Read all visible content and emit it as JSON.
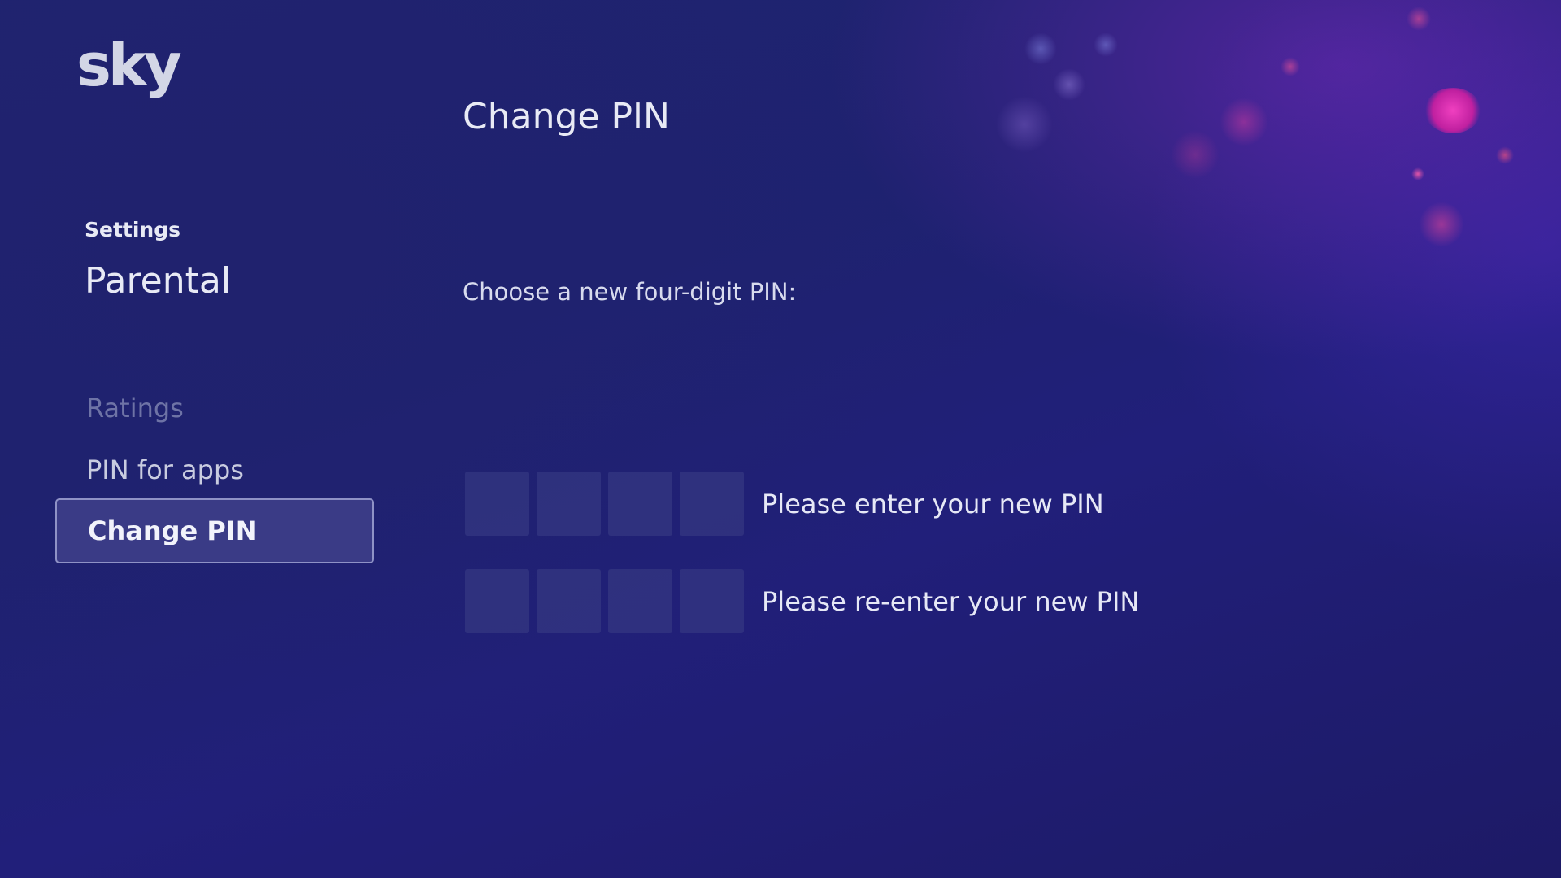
{
  "brand": {
    "logo_text": "sky"
  },
  "sidebar": {
    "settings_label": "Settings",
    "section_title": "Parental",
    "items": [
      {
        "label": "Ratings",
        "state": "disabled"
      },
      {
        "label": "PIN for apps",
        "state": "normal"
      },
      {
        "label": "Change PIN",
        "state": "selected"
      }
    ]
  },
  "main": {
    "title": "Change PIN",
    "instruction": "Choose a new four-digit PIN:",
    "pin_entry": {
      "digits": 4,
      "label": "Please enter your new PIN",
      "value": ""
    },
    "pin_confirm": {
      "digits": 4,
      "label": "Please re-enter your new PIN",
      "value": ""
    }
  },
  "colors": {
    "background": "#1f2470",
    "selected_item": "#3a3b86",
    "pin_box": "#343782",
    "accent_pink": "#e02aa8"
  }
}
